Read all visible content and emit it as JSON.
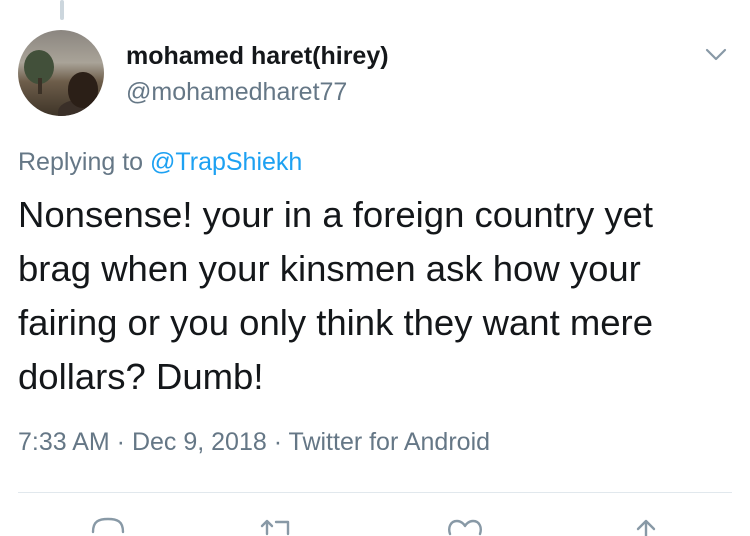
{
  "author": {
    "name": "mohamed haret(hirey)",
    "handle": "@mohamedharet77"
  },
  "reply": {
    "prefix": "Replying to ",
    "mention": "@TrapShiekh"
  },
  "tweet": {
    "lines": [
      "Nonsense! your in a foreign country yet",
      "brag when your kinsmen ask how your",
      "fairing or you only think they want mere",
      "dollars? Dumb!"
    ]
  },
  "meta": {
    "time": "7:33 AM",
    "separator": " · ",
    "date": "Dec 9, 2018",
    "source": "Twitter for Android"
  },
  "colors": {
    "text": "#14171a",
    "secondary": "#657786",
    "link": "#1da1f2",
    "divider": "#e1e8ed"
  },
  "icons": [
    "chevron-down-icon",
    "reply-icon",
    "retweet-icon",
    "like-icon",
    "share-icon"
  ]
}
